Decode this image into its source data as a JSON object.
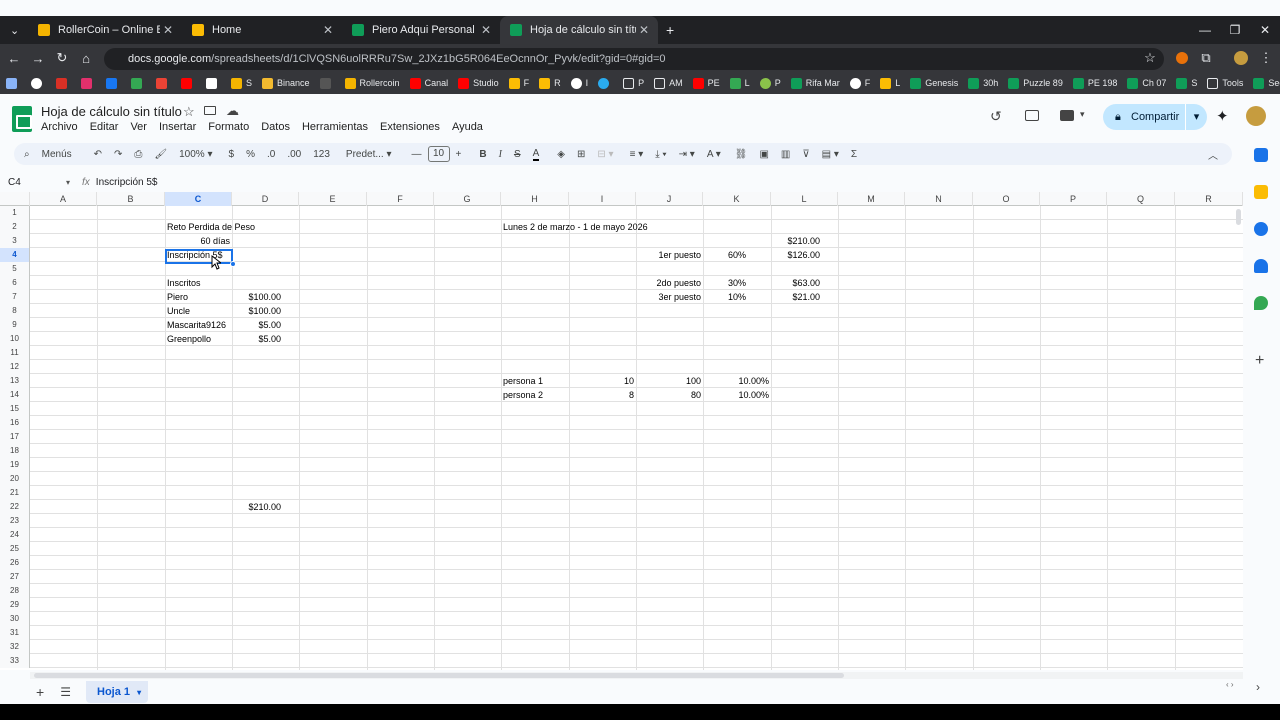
{
  "browser": {
    "tabs": [
      {
        "title": "RollerCoin – Online Bitcoin Mini",
        "color": "#f4b400"
      },
      {
        "title": "Home",
        "color": "#fbbc04"
      },
      {
        "title": "Piero Adqui Personal - Hojas d",
        "color": "#0f9d58"
      },
      {
        "title": "Hoja de cálculo sin título - Hoja",
        "color": "#0f9d58"
      }
    ],
    "url_domain": "docs.google.com",
    "url_path": "/spreadsheets/d/1ClVQSN6uolRRRu7Sw_2JXz1bG5R064EeOcnnOr_Pyvk/edit?gid=0#gid=0",
    "bookmarks": [
      "S",
      "Binance",
      "Rollercoin",
      "Canal",
      "Studio",
      "F",
      "R",
      "I",
      "P",
      "AM",
      "PE",
      "L",
      "P",
      "Rifa Mar",
      "F",
      "L",
      "Genesis",
      "30h",
      "Puzzle 89",
      "PE 198",
      "Ch 07",
      "S",
      "Tools",
      "Seeds"
    ]
  },
  "sheets": {
    "doc_title": "Hoja de cálculo sin título",
    "menus": [
      "Archivo",
      "Editar",
      "Ver",
      "Insertar",
      "Formato",
      "Datos",
      "Herramientas",
      "Extensiones",
      "Ayuda"
    ],
    "share_label": "Compartir",
    "toolbar": {
      "search": "Menús",
      "zoom": "100%",
      "currency": "$",
      "percent": "%",
      "dec_minus": ".0",
      "dec_plus": ".00",
      "format_num": "123",
      "font": "Predet...",
      "font_size": "10"
    },
    "name_box": "C4",
    "formula": "Inscripción 5$",
    "columns": [
      "A",
      "B",
      "C",
      "D",
      "E",
      "F",
      "G",
      "H",
      "I",
      "J",
      "K",
      "L",
      "M",
      "N",
      "O",
      "P",
      "Q",
      "R"
    ],
    "rows": [
      "1",
      "2",
      "3",
      "4",
      "5",
      "6",
      "7",
      "8",
      "9",
      "10",
      "11",
      "12",
      "13",
      "14",
      "15",
      "16",
      "17",
      "18",
      "19",
      "20",
      "21",
      "22",
      "23",
      "24",
      "25",
      "26",
      "27",
      "28",
      "29",
      "30",
      "31",
      "32",
      "33"
    ],
    "cells": {
      "C2": "Reto Perdida de Peso",
      "C3": "60 días",
      "C4": "Inscripción 5$",
      "C6": "Inscritos",
      "C7": "Piero",
      "D7": "$100.00",
      "C8": "Uncle",
      "D8": "$100.00",
      "C9": "Mascarita9126",
      "D9": "$5.00",
      "C10": "Greenpollo",
      "D10": "$5.00",
      "D22": "$210.00",
      "H2": "Lunes 2 de marzo - 1 de mayo 2026",
      "L3": "$210.00",
      "J4": "1er puesto",
      "K4": "60%",
      "L4": "$126.00",
      "J6": "2do puesto",
      "K6": "30%",
      "L6": "$63.00",
      "J7": "3er puesto",
      "K7": "10%",
      "L7": "$21.00",
      "H13": "persona 1",
      "I13": "10",
      "J13": "100",
      "K13": "10.00%",
      "H14": "persona 2",
      "I14": "8",
      "J14": "80",
      "K14": "10.00%"
    },
    "sheet_tab": "Hoja 1"
  }
}
